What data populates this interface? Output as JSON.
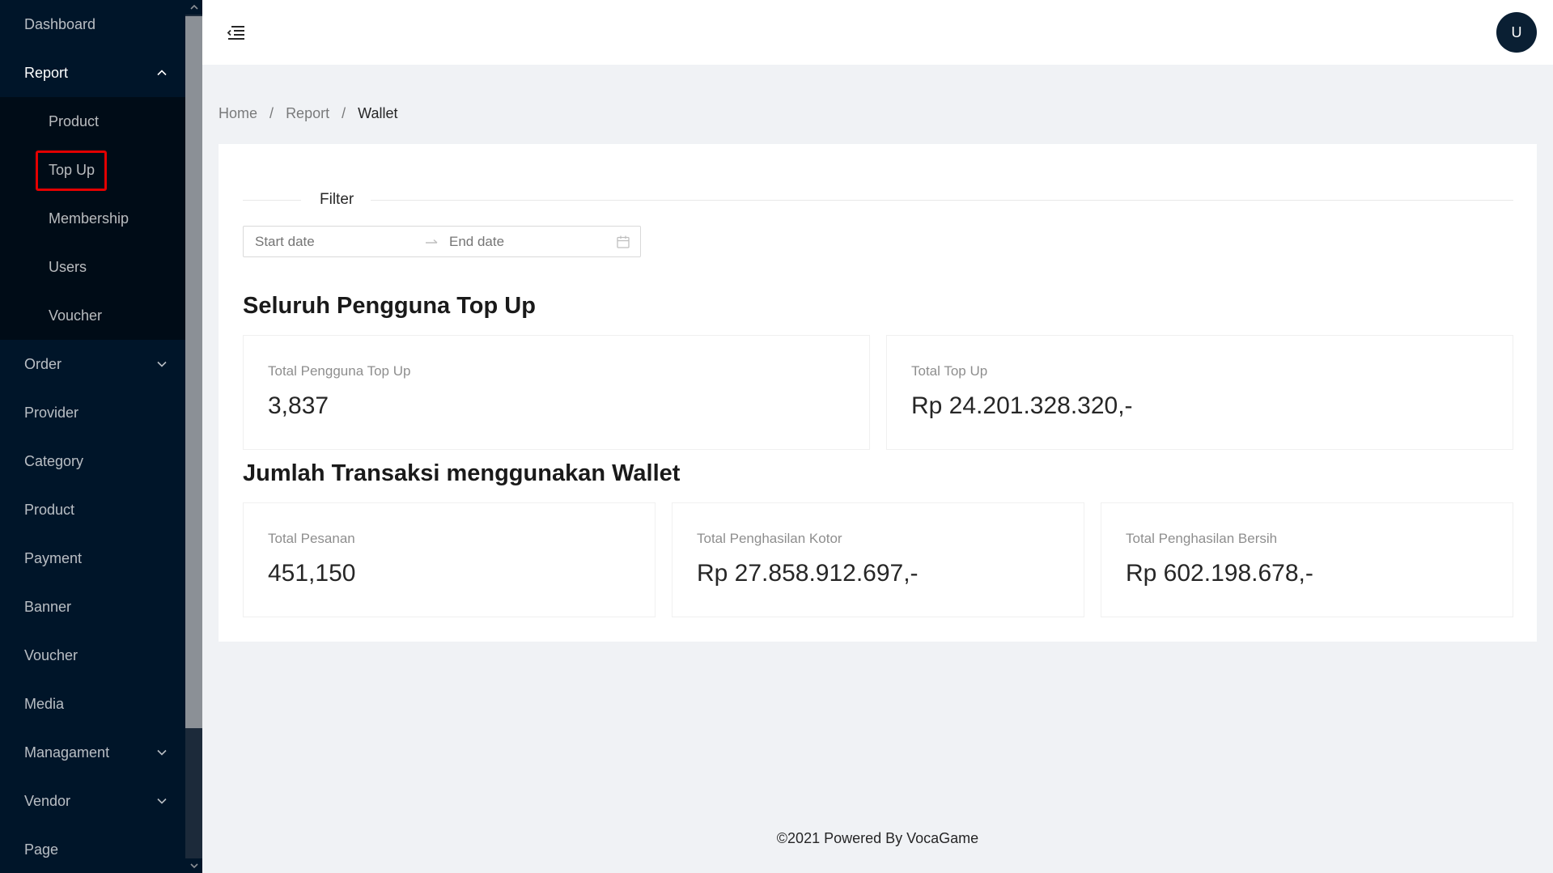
{
  "sidebar": {
    "items": [
      {
        "label": "Dashboard"
      },
      {
        "label": "Report",
        "expanded": true,
        "children": [
          {
            "label": "Product"
          },
          {
            "label": "Top Up",
            "highlighted": true
          },
          {
            "label": "Membership"
          },
          {
            "label": "Users"
          },
          {
            "label": "Voucher"
          }
        ]
      },
      {
        "label": "Order",
        "has_submenu": true
      },
      {
        "label": "Provider"
      },
      {
        "label": "Category"
      },
      {
        "label": "Product"
      },
      {
        "label": "Payment"
      },
      {
        "label": "Banner"
      },
      {
        "label": "Voucher"
      },
      {
        "label": "Media"
      },
      {
        "label": "Managament",
        "has_submenu": true
      },
      {
        "label": "Vendor",
        "has_submenu": true
      },
      {
        "label": "Page"
      }
    ]
  },
  "header": {
    "menu_toggle_icon": "menu-fold-icon",
    "avatar_initial": "U"
  },
  "breadcrumb": {
    "items": [
      "Home",
      "Report",
      "Wallet"
    ],
    "separator": "/"
  },
  "filter": {
    "label": "Filter",
    "start_placeholder": "Start date",
    "end_placeholder": "End date"
  },
  "sections": {
    "topup": {
      "title": "Seluruh Pengguna Top Up",
      "cards": [
        {
          "label": "Total Pengguna Top Up",
          "value": "3,837"
        },
        {
          "label": "Total Top Up",
          "value": "Rp 24.201.328.320,-"
        }
      ]
    },
    "wallet": {
      "title": "Jumlah Transaksi menggunakan Wallet",
      "cards": [
        {
          "label": "Total Pesanan",
          "value": "451,150"
        },
        {
          "label": "Total Penghasilan Kotor",
          "value": "Rp 27.858.912.697,-"
        },
        {
          "label": "Total Penghasilan Bersih",
          "value": "Rp 602.198.678,-"
        }
      ]
    }
  },
  "footer": {
    "text": "©2021 Powered By VocaGame"
  },
  "colors": {
    "sidebar_bg": "#001529",
    "submenu_bg": "#000c17",
    "highlight": "#e30000",
    "avatar_bg": "#0a1f33",
    "page_bg": "#f0f2f5"
  }
}
